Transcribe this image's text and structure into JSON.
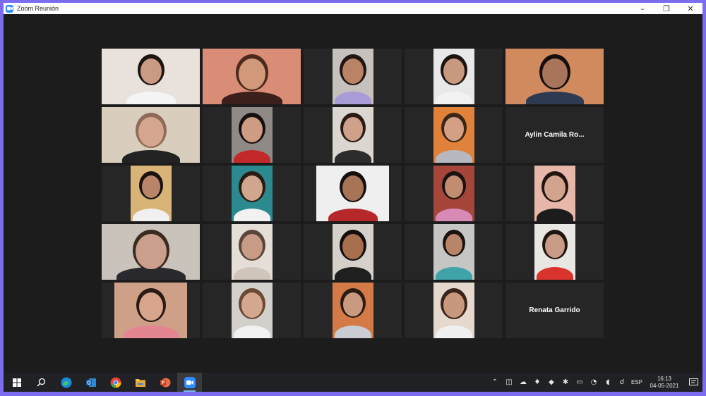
{
  "window": {
    "title": "Zoom Reunión",
    "controls": {
      "minimize": "–",
      "maximize": "❐",
      "close": "✕"
    }
  },
  "participants": [
    {
      "name": "",
      "video": true,
      "active": false,
      "bg": "#e9e2dc",
      "skin": "#c99b84",
      "hair": "#1d1410",
      "shirt": "#f4f4f4",
      "hw": 30
    },
    {
      "name": "",
      "video": true,
      "active": true,
      "bg": "#d98d76",
      "skin": "#d1997a",
      "hair": "#4a2a1a",
      "shirt": "#3a1f1a",
      "hw": 38
    },
    {
      "name": "",
      "video": true,
      "active": false,
      "bg": "#c6c1bc",
      "skin": "#b98466",
      "hair": "#201510",
      "shirt": "#a89bd6",
      "hw": 30
    },
    {
      "name": "",
      "video": true,
      "active": false,
      "bg": "#e8e8e8",
      "skin": "#c79a80",
      "hair": "#1d1410",
      "shirt": "#f2f2f2",
      "hw": 30
    },
    {
      "name": "",
      "video": true,
      "active": false,
      "bg": "#d08a5e",
      "skin": "#a8745a",
      "hair": "#140e0c",
      "shirt": "#2d3a52",
      "hw": 36
    },
    {
      "name": "",
      "video": true,
      "active": false,
      "bg": "#d9cdbd",
      "skin": "#d4a690",
      "hair": "#8e6b58",
      "shirt": "#222222",
      "hw": 36
    },
    {
      "name": "",
      "video": true,
      "active": false,
      "bg": "#8f8a86",
      "skin": "#cd9c82",
      "hair": "#161010",
      "shirt": "#c3292b",
      "hw": 30
    },
    {
      "name": "",
      "video": true,
      "active": false,
      "bg": "#dcd6d0",
      "skin": "#cfa18a",
      "hair": "#2a1a14",
      "shirt": "#2c2c2c",
      "hw": 28
    },
    {
      "name": "",
      "video": true,
      "active": false,
      "bg": "#e0823a",
      "skin": "#d3a085",
      "hair": "#3a2518",
      "shirt": "#b7b9c0",
      "hw": 28
    },
    {
      "name": "Aylin Camila Ro...",
      "video": false,
      "active": false
    },
    {
      "name": "",
      "video": true,
      "active": false,
      "bg": "#d8b477",
      "skin": "#b9856a",
      "hair": "#1b1310",
      "shirt": "#f0f0f0",
      "hw": 26
    },
    {
      "name": "",
      "video": true,
      "active": false,
      "bg": "#2b8a8f",
      "skin": "#d0a68e",
      "hair": "#2a1b12",
      "shirt": "#f2f2f2",
      "hw": 30
    },
    {
      "name": "",
      "video": true,
      "active": false,
      "bg": "#efefef",
      "skin": "#a87458",
      "hair": "#15100e",
      "shirt": "#b6282a",
      "hw": 30
    },
    {
      "name": "",
      "video": true,
      "active": false,
      "bg": "#a6463a",
      "skin": "#c18c70",
      "hair": "#1b1310",
      "shirt": "#d68ab5",
      "hw": 26
    },
    {
      "name": "",
      "video": true,
      "active": false,
      "bg": "#e7b8a9",
      "skin": "#d2a48e",
      "hair": "#22150f",
      "shirt": "#1c1c1c",
      "hw": 30
    },
    {
      "name": "",
      "video": true,
      "active": false,
      "bg": "#c9c3bb",
      "skin": "#caa08d",
      "hair": "#3b2a20",
      "shirt": "#2a2a2e",
      "hw": 44
    },
    {
      "name": "",
      "video": true,
      "active": false,
      "bg": "#e4ded7",
      "skin": "#c79b85",
      "hair": "#5a4639",
      "shirt": "#cfc5bb",
      "hw": 30
    },
    {
      "name": "",
      "video": true,
      "active": false,
      "bg": "#d6d0ca",
      "skin": "#a6704f",
      "hair": "#130d0b",
      "shirt": "#1f1f1f",
      "hw": 30
    },
    {
      "name": "",
      "video": true,
      "active": false,
      "bg": "#c6c6c4",
      "skin": "#b9856a",
      "hair": "#1b1310",
      "shirt": "#3fa3a8",
      "hw": 24
    },
    {
      "name": "",
      "video": true,
      "active": false,
      "bg": "#e9e7e3",
      "skin": "#c79b85",
      "hair": "#1f150f",
      "shirt": "#d8332c",
      "hw": 28
    },
    {
      "name": "",
      "video": true,
      "active": false,
      "bg": "#cfa088",
      "skin": "#d6a58c",
      "hair": "#2a1a12",
      "shirt": "#e48592",
      "hw": 34
    },
    {
      "name": "",
      "video": true,
      "active": false,
      "bg": "#d3d0cb",
      "skin": "#d4a78f",
      "hair": "#6b4a33",
      "shirt": "#f2f2f2",
      "hw": 30
    },
    {
      "name": "",
      "video": true,
      "active": false,
      "bg": "#d47a47",
      "skin": "#c99a80",
      "hair": "#2b1b12",
      "shirt": "#c9ccd2",
      "hw": 28
    },
    {
      "name": "",
      "video": true,
      "active": false,
      "bg": "#e5d9cd",
      "skin": "#c8987e",
      "hair": "#3a2418",
      "shirt": "#f0f0f0",
      "hw": 30
    },
    {
      "name": "Renata Garrido",
      "video": false,
      "active": false
    }
  ],
  "taskbar": {
    "apps": [
      {
        "name": "start-icon",
        "color": "#ffffff",
        "active": false
      },
      {
        "name": "search-icon",
        "color": "#ffffff",
        "active": false
      },
      {
        "name": "edge-icon",
        "color": "#2fa8e0",
        "active": false
      },
      {
        "name": "outlook-icon",
        "color": "#1e6ec8",
        "active": false
      },
      {
        "name": "chrome-icon",
        "color": "#e8453c",
        "active": false
      },
      {
        "name": "file-explorer-icon",
        "color": "#f2c14e",
        "active": false
      },
      {
        "name": "powerpoint-icon",
        "color": "#d24726",
        "active": false
      },
      {
        "name": "zoom-icon",
        "color": "#2d8cff",
        "active": true
      }
    ],
    "tray": {
      "icons": [
        "⌃",
        "◫",
        "☁",
        "♦",
        "◆",
        "✱",
        "▭",
        "◔",
        "◖",
        "☌"
      ],
      "lang": "ESP",
      "time": "16:13",
      "date": "04-05-2021"
    }
  }
}
